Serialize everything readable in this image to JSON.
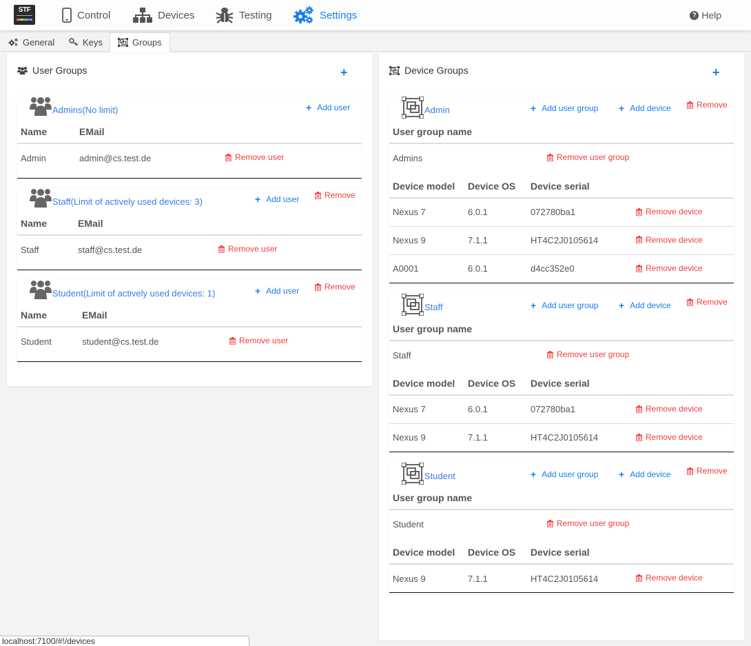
{
  "nav": {
    "logo_text": "STF",
    "items": [
      {
        "label": "Control",
        "icon": "phone-icon"
      },
      {
        "label": "Devices",
        "icon": "sitemap-icon"
      },
      {
        "label": "Testing",
        "icon": "bug-icon"
      },
      {
        "label": "Settings",
        "icon": "gears-icon",
        "active": true
      }
    ],
    "help_label": "Help"
  },
  "subtabs": [
    {
      "label": "General",
      "icon": "gears-icon"
    },
    {
      "label": "Keys",
      "icon": "key-icon"
    },
    {
      "label": "Groups",
      "icon": "object-group-icon",
      "active": true
    }
  ],
  "user_groups": {
    "title": "User Groups",
    "add_symbol": "+",
    "columns": [
      "Name",
      "EMail"
    ],
    "add_user_label": "Add user",
    "remove_label": "Remove",
    "remove_user_label": "Remove user",
    "groups": [
      {
        "name": "Admins(No limit)",
        "removable": false,
        "users": [
          {
            "name": "Admin",
            "email": "admin@cs.test.de"
          }
        ]
      },
      {
        "name": "Staff(Limit of actively used devices: 3)",
        "removable": true,
        "users": [
          {
            "name": "Staff",
            "email": "staff@cs.test.de"
          }
        ]
      },
      {
        "name": "Student(Limit of actively used devices: 1)",
        "removable": true,
        "users": [
          {
            "name": "Student",
            "email": "student@cs.test.de"
          }
        ]
      }
    ]
  },
  "device_groups": {
    "title": "Device Groups",
    "add_symbol": "+",
    "add_user_group_label": "Add user group",
    "add_device_label": "Add device",
    "remove_label": "Remove",
    "user_group_column": "User group name",
    "remove_user_group_label": "Remove user group",
    "device_columns": [
      "Device model",
      "Device OS",
      "Device serial"
    ],
    "remove_device_label": "Remove device",
    "groups": [
      {
        "name": "Admin",
        "user_groups": [
          "Admins"
        ],
        "devices": [
          {
            "model": "Nexus 7",
            "os": "6.0.1",
            "serial": "072780ba1"
          },
          {
            "model": "Nexus 9",
            "os": "7.1.1",
            "serial": "HT4C2J0105614"
          },
          {
            "model": "A0001",
            "os": "6.0.1",
            "serial": "d4cc352e0"
          }
        ]
      },
      {
        "name": "Staff",
        "user_groups": [
          "Staff"
        ],
        "devices": [
          {
            "model": "Nexus 7",
            "os": "6.0.1",
            "serial": "072780ba1"
          },
          {
            "model": "Nexus 9",
            "os": "7.1.1",
            "serial": "HT4C2J0105614"
          }
        ]
      },
      {
        "name": "Student",
        "user_groups": [
          "Student"
        ],
        "devices": [
          {
            "model": "Nexus 9",
            "os": "7.1.1",
            "serial": "HT4C2J0105614"
          }
        ]
      }
    ]
  },
  "status_url": "localhost:7100/#!/devices",
  "colors": {
    "accent": "#167fe8",
    "danger": "#f43b3b",
    "link": "#3a7ee0"
  }
}
